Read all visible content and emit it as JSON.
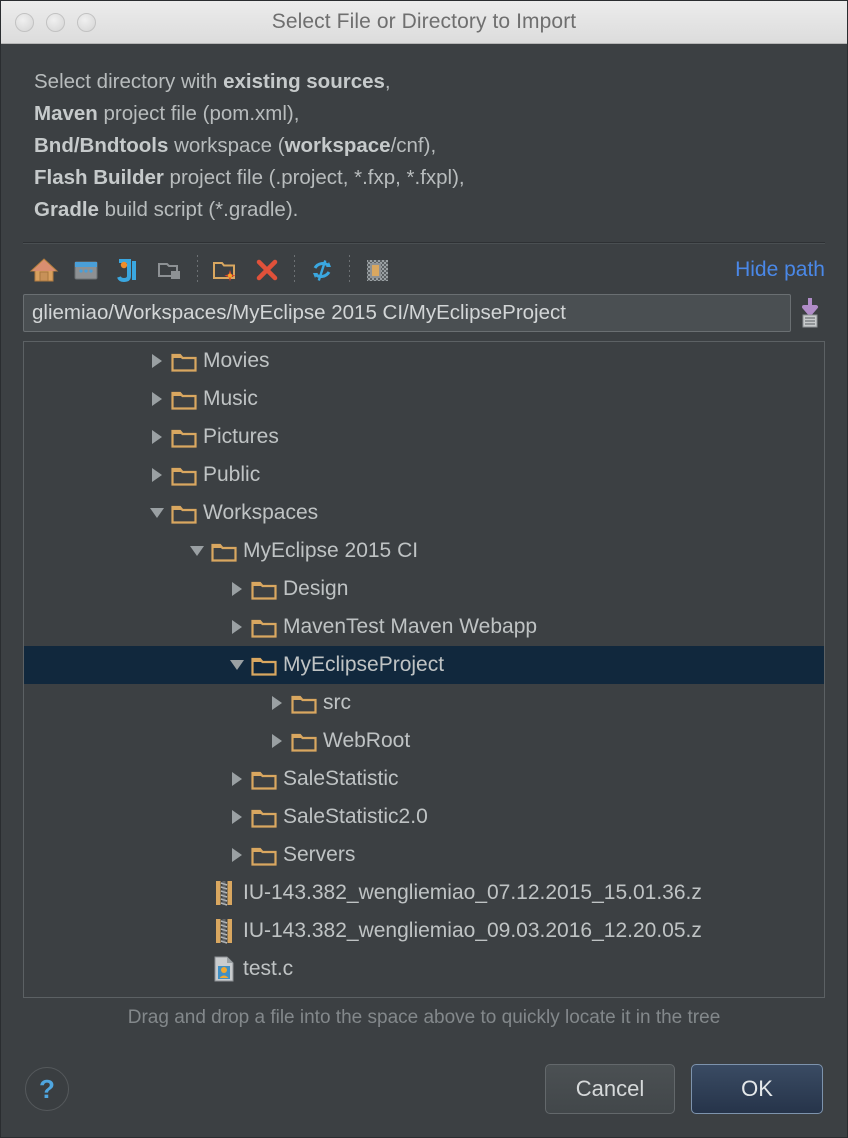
{
  "window": {
    "title": "Select File or Directory to Import",
    "traffic_lights": [
      "close",
      "minimize",
      "zoom"
    ]
  },
  "description": {
    "lines": [
      [
        {
          "t": "Select directory with ",
          "b": false
        },
        {
          "t": "existing sources",
          "b": true
        },
        {
          "t": ",",
          "b": false
        }
      ],
      [
        {
          "t": "Maven",
          "b": true
        },
        {
          "t": " project file (pom.xml),",
          "b": false
        }
      ],
      [
        {
          "t": "Bnd/Bndtools",
          "b": true
        },
        {
          "t": " workspace (",
          "b": false
        },
        {
          "t": "workspace",
          "b": true
        },
        {
          "t": "/cnf),",
          "b": false
        }
      ],
      [
        {
          "t": "Flash Builder",
          "b": true
        },
        {
          "t": " project file (.project, *.fxp, *.fxpl),",
          "b": false
        }
      ],
      [
        {
          "t": "Gradle",
          "b": true
        },
        {
          "t": " build script (*.gradle).",
          "b": false
        }
      ]
    ]
  },
  "toolbar": {
    "buttons": [
      {
        "name": "home-icon",
        "tooltip": "Home"
      },
      {
        "name": "desktop-icon",
        "tooltip": "Desktop"
      },
      {
        "name": "intellij-project-icon",
        "tooltip": "Project Directory"
      },
      {
        "name": "module-directory-icon",
        "tooltip": "Module Directory"
      },
      {
        "name": "new-folder-icon",
        "tooltip": "New Folder"
      },
      {
        "name": "delete-icon",
        "tooltip": "Delete"
      },
      {
        "name": "refresh-icon",
        "tooltip": "Refresh"
      },
      {
        "name": "show-hidden-files-icon",
        "tooltip": "Show Hidden Files and Directories"
      }
    ],
    "hide_path_label": "Hide path"
  },
  "path": {
    "value": "gliemiao/Workspaces/MyEclipse 2015 CI/MyEclipseProject",
    "placeholder": "",
    "history_icon": "history-dropdown-icon"
  },
  "tree": {
    "rows": [
      {
        "label": "Movies",
        "depth": 3,
        "state": "collapsed",
        "icon": "folder-icon",
        "selected": false
      },
      {
        "label": "Music",
        "depth": 3,
        "state": "collapsed",
        "icon": "folder-icon",
        "selected": false
      },
      {
        "label": "Pictures",
        "depth": 3,
        "state": "collapsed",
        "icon": "folder-icon",
        "selected": false
      },
      {
        "label": "Public",
        "depth": 3,
        "state": "collapsed",
        "icon": "folder-icon",
        "selected": false
      },
      {
        "label": "Workspaces",
        "depth": 3,
        "state": "expanded",
        "icon": "folder-icon",
        "selected": false
      },
      {
        "label": "MyEclipse 2015 CI",
        "depth": 4,
        "state": "expanded",
        "icon": "folder-icon",
        "selected": false
      },
      {
        "label": "Design",
        "depth": 5,
        "state": "collapsed",
        "icon": "folder-icon",
        "selected": false
      },
      {
        "label": "MavenTest Maven Webapp",
        "depth": 5,
        "state": "collapsed",
        "icon": "folder-icon",
        "selected": false
      },
      {
        "label": "MyEclipseProject",
        "depth": 5,
        "state": "expanded",
        "icon": "folder-icon",
        "selected": true
      },
      {
        "label": "src",
        "depth": 6,
        "state": "collapsed",
        "icon": "folder-icon",
        "selected": false
      },
      {
        "label": "WebRoot",
        "depth": 6,
        "state": "collapsed",
        "icon": "folder-icon",
        "selected": false
      },
      {
        "label": "SaleStatistic",
        "depth": 5,
        "state": "collapsed",
        "icon": "folder-icon",
        "selected": false
      },
      {
        "label": "SaleStatistic2.0",
        "depth": 5,
        "state": "collapsed",
        "icon": "folder-icon",
        "selected": false
      },
      {
        "label": "Servers",
        "depth": 5,
        "state": "collapsed",
        "icon": "folder-icon",
        "selected": false
      },
      {
        "label": "IU-143.382_wengliemiao_07.12.2015_15.01.36.z",
        "depth": 4,
        "state": "leaf",
        "icon": "zip-file-icon",
        "selected": false
      },
      {
        "label": "IU-143.382_wengliemiao_09.03.2016_12.20.05.z",
        "depth": 4,
        "state": "leaf",
        "icon": "zip-file-icon",
        "selected": false
      },
      {
        "label": "test.c",
        "depth": 4,
        "state": "leaf",
        "icon": "c-file-icon",
        "selected": false
      },
      {
        "label": "",
        "depth": 3,
        "state": "collapsed",
        "icon": "folder-icon",
        "selected": false
      }
    ]
  },
  "hint": "Drag and drop a file into the space above to quickly locate it in the tree",
  "footer": {
    "help_label": "?",
    "cancel_label": "Cancel",
    "ok_label": "OK"
  },
  "colors": {
    "window_bg": "#3c4043",
    "titlebar_bg": "#e4e4e4",
    "selection_bg": "#11283d",
    "link_blue": "#4a88e8",
    "folder_amber": "#d9a760",
    "text": "#bfc3c4"
  }
}
